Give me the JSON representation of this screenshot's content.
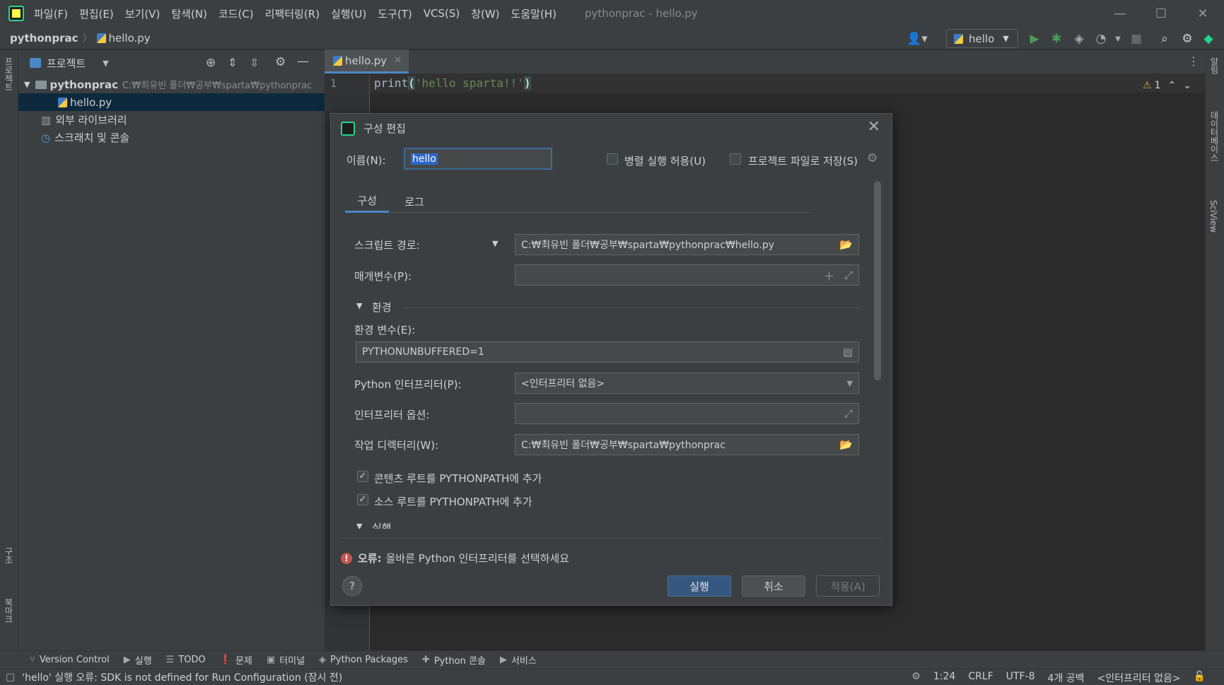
{
  "window": {
    "title": "pythonprac - hello.py",
    "menu": [
      "파일(F)",
      "편집(E)",
      "보기(V)",
      "탐색(N)",
      "코드(C)",
      "리팩터링(R)",
      "실행(U)",
      "도구(T)",
      "VCS(S)",
      "창(W)",
      "도움말(H)"
    ]
  },
  "nav": {
    "project": "pythonprac",
    "file": "hello.py",
    "run_config": "hello"
  },
  "project_panel": {
    "title": "프로젝트",
    "root_name": "pythonprac",
    "root_path": "C:₩최유빈 폴더₩공부₩sparta₩pythonprac",
    "file": "hello.py",
    "external_libs": "외부 라이브러리",
    "scratches": "스크래치 및 콘솔"
  },
  "left_strip": {
    "project": "프로젝트",
    "structure": "구조",
    "bookmarks": "북마크"
  },
  "right_strip": {
    "notifications": "알림",
    "database": "데이터베이스",
    "sciview": "SciView"
  },
  "editor": {
    "tab": "hello.py",
    "line_number": "1",
    "code_func": "print",
    "code_open": "(",
    "code_string": "'hello sparta!!'",
    "code_close": ")",
    "warnings": "1"
  },
  "dialog": {
    "title": "구성 편집",
    "name_label": "이름(N):",
    "name_value": "hello",
    "allow_parallel": "병렬 실행 허용(U)",
    "store_project": "프로젝트 파일로 저장(S)",
    "tabs": [
      "구성",
      "로그"
    ],
    "script_label": "스크립트 경로:",
    "script_value": "C:₩최유빈 폴더₩공부₩sparta₩pythonprac₩hello.py",
    "params_label": "매개변수(P):",
    "env_section": "환경",
    "env_label": "환경 변수(E):",
    "env_value": "PYTHONUNBUFFERED=1",
    "interpreter_label": "Python 인터프리터(P):",
    "interpreter_value": "<인터프리터 없음>",
    "interp_options_label": "인터프리터 옵션:",
    "workdir_label": "작업 디렉터리(W):",
    "workdir_value": "C:₩최유빈 폴더₩공부₩sparta₩pythonprac",
    "content_roots": "콘텐츠 루트를 PYTHONPATH에 추가",
    "source_roots": "소스 루트를 PYTHONPATH에 추가",
    "exec_section": "실행",
    "error_prefix": "오류:",
    "error_text": "올바른 Python 인터프리터를 선택하세요",
    "run_btn": "실행",
    "cancel_btn": "취소",
    "apply_btn": "적용(A)"
  },
  "bottom_tools": [
    "Version Control",
    "실행",
    "TODO",
    "문제",
    "터미널",
    "Python Packages",
    "Python 콘솔",
    "서비스"
  ],
  "status": {
    "message": "'hello' 실행 오류: SDK is not defined for Run Configuration (잠시 전)",
    "position": "1:24",
    "line_sep": "CRLF",
    "encoding": "UTF-8",
    "indent": "4개 공백",
    "interpreter": "<인터프리터 없음>"
  }
}
